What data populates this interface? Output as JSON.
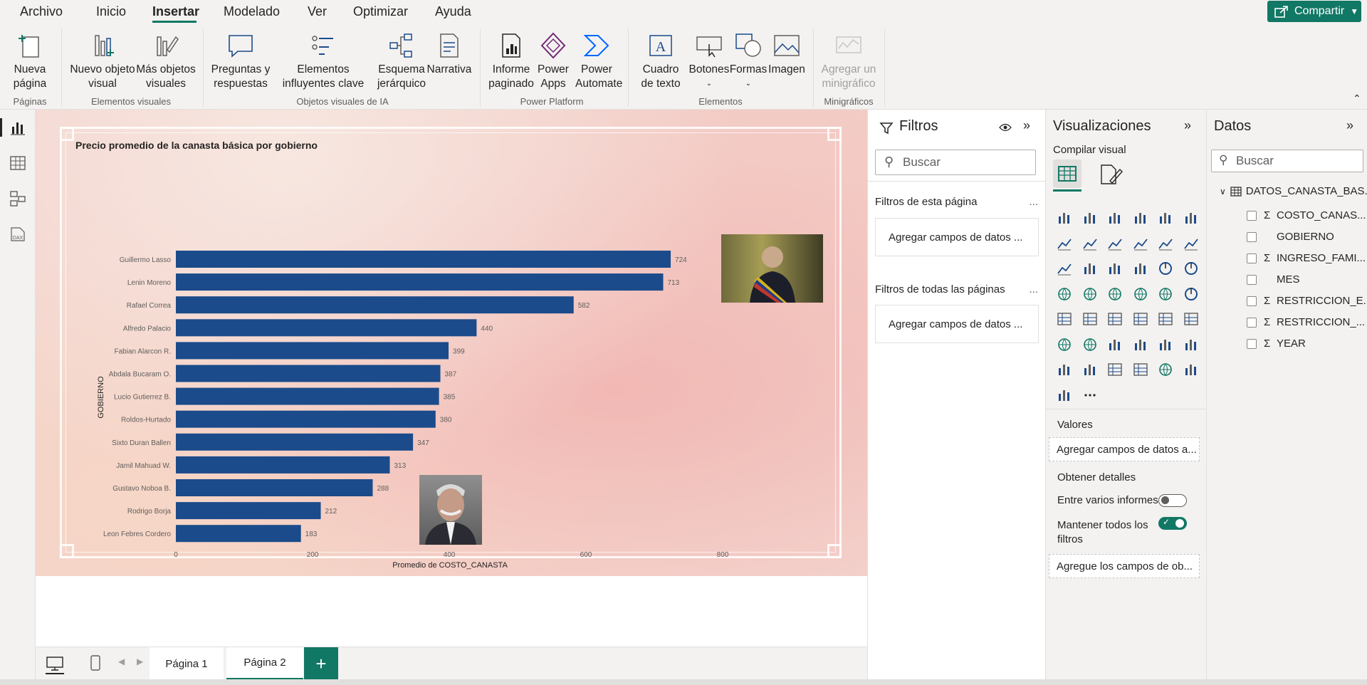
{
  "menu": {
    "items": [
      "Archivo",
      "Inicio",
      "Insertar",
      "Modelado",
      "Ver",
      "Optimizar",
      "Ayuda"
    ],
    "active": "Insertar",
    "share_label": "Compartir"
  },
  "ribbon": {
    "nueva_pagina": "Nueva página",
    "nuevo_objeto_visual": "Nuevo objeto visual",
    "mas_objetos_visuales": "Más objetos visuales",
    "preguntas_respuestas": "Preguntas y respuestas",
    "elementos_influyentes": "Elementos influyentes clave",
    "esquema_jerarquico": "Esquema jerárquico",
    "narrativa": "Narrativa",
    "informe_paginado": "Informe paginado",
    "power_apps": "Power Apps",
    "power_automate": "Power Automate",
    "cuadro_texto": "Cuadro de texto",
    "botones": "Botones",
    "formas": "Formas",
    "imagen": "Imagen",
    "agregar_minigrafico": "Agregar un minigráfico",
    "groups": {
      "paginas": "Páginas",
      "elementos_visuales": "Elementos visuales",
      "objetos_ia": "Objetos visuales de IA",
      "power_platform": "Power Platform",
      "elementos": "Elementos",
      "minigraficos": "Minigráficos"
    }
  },
  "chart_data": {
    "type": "bar",
    "orientation": "horizontal",
    "title": "Precio promedio de la canasta básica por gobierno",
    "xlabel": "Promedio de COSTO_CANASTA",
    "ylabel": "GOBIERNO",
    "xlim": [
      0,
      800
    ],
    "xticks": [
      "0",
      "200",
      "400",
      "600",
      "800"
    ],
    "categories": [
      "Guillermo Lasso",
      "Lenin Moreno",
      "Rafael Correa",
      "Alfredo Palacio",
      "Fabian Alarcon R.",
      "Abdala Bucaram O.",
      "Lucio Gutierrez B.",
      "Roldos-Hurtado",
      "Sixto Duran Ballen",
      "Jamil Mahuad W.",
      "Gustavo Noboa B.",
      "Rodrigo Borja",
      "Leon Febres Cordero"
    ],
    "values": [
      724,
      713,
      582,
      440,
      399,
      387,
      385,
      380,
      347,
      313,
      288,
      212,
      183
    ],
    "bar_color": "#1b4b8a",
    "grid": false
  },
  "page_tabs": {
    "tabs": [
      "Página 1",
      "Página 2"
    ],
    "active": "Página 2",
    "add_label": "+"
  },
  "filters": {
    "title": "Filtros",
    "search_placeholder": "Buscar",
    "this_page": "Filtros de esta página",
    "all_pages": "Filtros de todas las páginas",
    "add_fields": "Agregar campos de datos ...",
    "more": "..."
  },
  "visualizations": {
    "title": "Visualizaciones",
    "build": "Compilar visual",
    "values_label": "Valores",
    "values_drop": "Agregar campos de datos a...",
    "details_label": "Obtener detalles",
    "cross_report": "Entre varios informes",
    "keep_filters": "Mantener todos los filtros",
    "drill_drop": "Agregue los campos de ob...",
    "more": "..."
  },
  "data_pane": {
    "title": "Datos",
    "search_placeholder": "Buscar",
    "table": "DATOS_CANASTA_BAS...",
    "fields": [
      {
        "name": "COSTO_CANAS...",
        "sigma": true
      },
      {
        "name": "GOBIERNO",
        "sigma": false
      },
      {
        "name": "INGRESO_FAMI...",
        "sigma": true
      },
      {
        "name": "MES",
        "sigma": false
      },
      {
        "name": "RESTRICCION_E...",
        "sigma": true
      },
      {
        "name": "RESTRICCION_...",
        "sigma": true
      },
      {
        "name": "YEAR",
        "sigma": true
      }
    ]
  },
  "colors": {
    "accent": "#117865",
    "bar": "#1b4b8a"
  }
}
